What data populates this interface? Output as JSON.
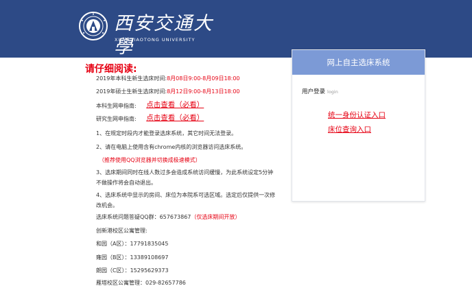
{
  "header": {
    "logo_cn": "西安交通大學",
    "logo_en": "XI'AN JIAOTONG UNIVERSITY"
  },
  "notice": {
    "title": "请仔细阅读:",
    "undergrad_time_label": "2019年本科生新生选床时间:",
    "undergrad_time_value": "8月08日9:00-8月09日18:00",
    "master_time_label": "2019年硕士生新生选床时间:",
    "master_time_value": "8月12日9:00-8月13日18:00",
    "undergrad_guide_label": "本科生网申指南:",
    "undergrad_guide_link": "点击查看（必看）",
    "grad_guide_label": "研究生网申指南:",
    "grad_guide_link": "点击查看（必看）",
    "rule_1": "1、在规定时段内才能登录选床系统，其它时间无法登录。",
    "rule_2": "2、请在电脑上使用含有chrome内核的浏览器访问选床系统。",
    "rule_2_tip": "（推荐使用QQ浏览器并切换成极速模式）",
    "rule_3": "3、选床期间同时在线人数过多会造成系统访问缓慢，为此系统设定5分钟不做操作将会自动退出。",
    "rule_4": "4、选床系统中显示的房间、床位为本院系可选区域。选定后仅提供一次修改机会。",
    "qq_label": "选床系统问题答疑QQ群：657673867",
    "qq_note": "（仅选床期间开放）",
    "campus_label": "创新港校区公寓管理:",
    "dorm_a": "和园（A区）：17791835045",
    "dorm_b": "雍园（B区）：13389108697",
    "dorm_c": "朗园（C区）：15295629373",
    "yanta": "雁塔校区公寓管理：029-82657786"
  },
  "panel": {
    "title": "网上自主选床系统",
    "login_label": "用户登录",
    "login_en": "login",
    "link_unified": "统一身份认证入口",
    "link_bed": "床位查询入口"
  }
}
